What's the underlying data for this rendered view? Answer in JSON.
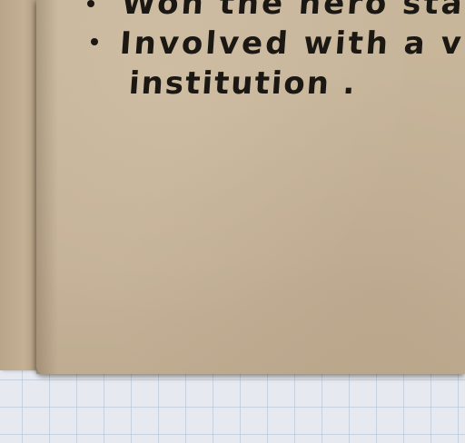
{
  "notebook": {
    "lines": [
      {
        "text": "Won the hero   sta"
      },
      {
        "text": "Involved  with a  v"
      },
      {
        "text": "institution ."
      }
    ]
  }
}
